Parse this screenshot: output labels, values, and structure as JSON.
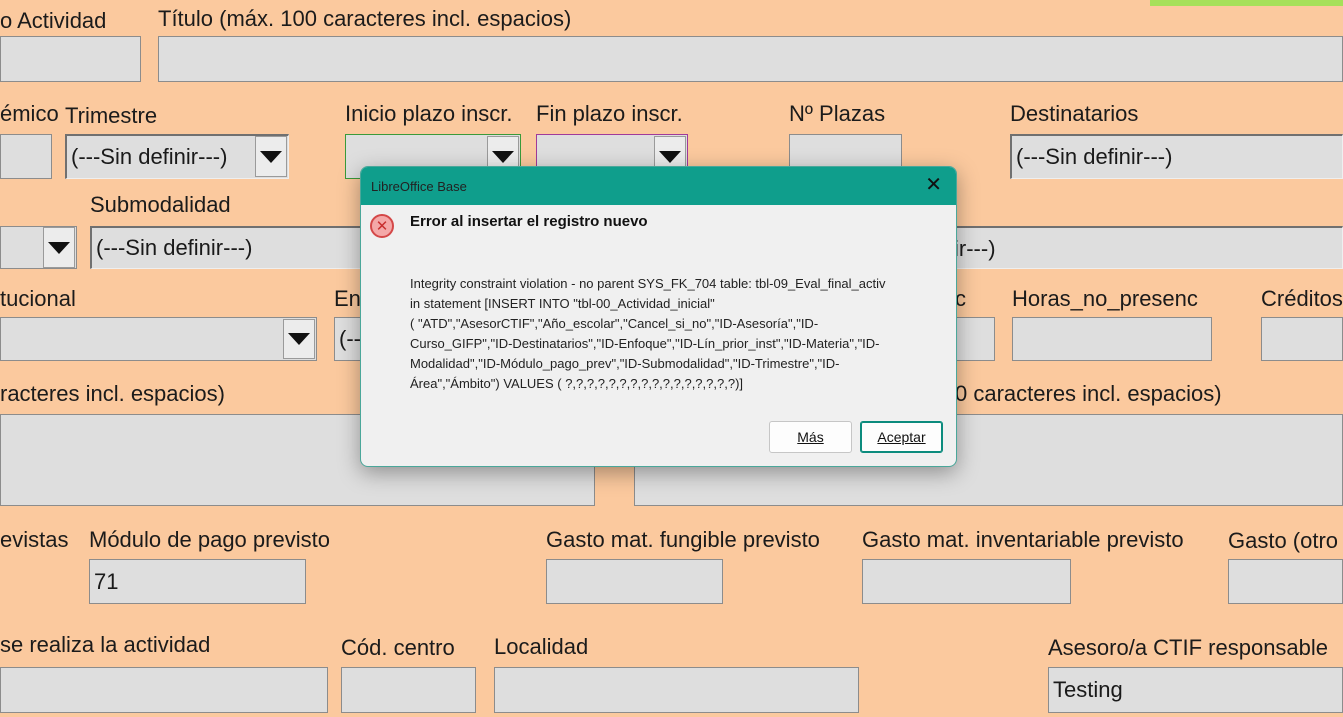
{
  "form": {
    "labels": {
      "actividad": "o Actividad",
      "titulo": "Título (máx. 100 caracteres incl. espacios)",
      "academico": "émico",
      "trimestre": "Trimestre",
      "inicio_plazo": "Inicio plazo inscr.",
      "fin_plazo": "Fin plazo inscr.",
      "plazas": "Nº Plazas",
      "destinatarios": "Destinatarios",
      "submodalidad": "Submodalidad",
      "institucional": "tucional",
      "en": "En",
      "presenc": "c",
      "horas_no_presenc": "Horas_no_presenc",
      "creditos": "Créditos",
      "caracteres_left": "racteres incl. espacios)",
      "caracteres_right": "0 caracteres incl. espacios)",
      "previstas": "evistas",
      "modulo_pago": "Módulo de pago previsto",
      "gasto_fungible": "Gasto mat. fungible previsto",
      "gasto_inventariable": "Gasto mat. inventariable previsto",
      "gasto_otros": "Gasto (otro",
      "lugar": "se realiza la actividad",
      "cod_centro": "Cód. centro",
      "localidad": "Localidad",
      "asesor": "Asesoro/a CTIF responsable"
    },
    "values": {
      "trimestre": "(---Sin definir---)",
      "destinatarios": "(---Sin definir---)",
      "submodalidad": "(---Sin definir---)",
      "partial_right": "ir---)",
      "en_partial": "(--",
      "modulo_pago": "71",
      "asesor": "Testing"
    }
  },
  "dialog": {
    "title": "LibreOffice Base",
    "close_glyph": "✕",
    "icon_glyph": "✕",
    "heading": "Error al insertar el registro nuevo",
    "message": "Integrity constraint violation - no parent SYS_FK_704 table: tbl-09_Eval_final_activ\nin statement [INSERT INTO \"tbl-00_Actividad_inicial\"\n( \"ATD\",\"AsesorCTIF\",\"Año_escolar\",\"Cancel_si_no\",\"ID-Asesoría\",\"ID-\nCurso_GIFP\",\"ID-Destinatarios\",\"ID-Enfoque\",\"ID-Lín_prior_inst\",\"ID-Materia\",\"ID-\nModalidad\",\"ID-Módulo_pago_prev\",\"ID-Submodalidad\",\"ID-Trimestre\",\"ID-\nÁrea\",\"Ámbito\") VALUES ( ?,?,?,?,?,?,?,?,?,?,?,?,?,?,?,?)]",
    "btn_more": "Más",
    "btn_accept": "Aceptar"
  },
  "colors": {
    "background": "#fbc99e",
    "field": "#dedede",
    "dialog_title": "#0f9e8c",
    "accent_green": "#a6e05a"
  }
}
